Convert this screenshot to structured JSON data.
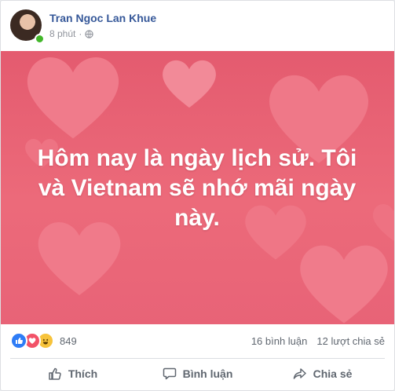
{
  "post": {
    "author": "Tran Ngoc Lan Khue",
    "time": "8 phút",
    "privacy_icon": "globe-icon",
    "text": "Hôm nay là ngày lịch sử. Tôi và Vietnam sẽ nhớ mãi ngày này.",
    "background": {
      "base_color": "#e45b6f",
      "heart_color": "#f06a7c"
    }
  },
  "stats": {
    "reaction_icons": [
      "like-icon",
      "love-icon",
      "haha-icon"
    ],
    "reaction_count": "849",
    "comments": "16 bình luận",
    "shares": "12 lượt chia sẻ"
  },
  "actions": {
    "like": "Thích",
    "comment": "Bình luận",
    "share": "Chia sẻ"
  }
}
